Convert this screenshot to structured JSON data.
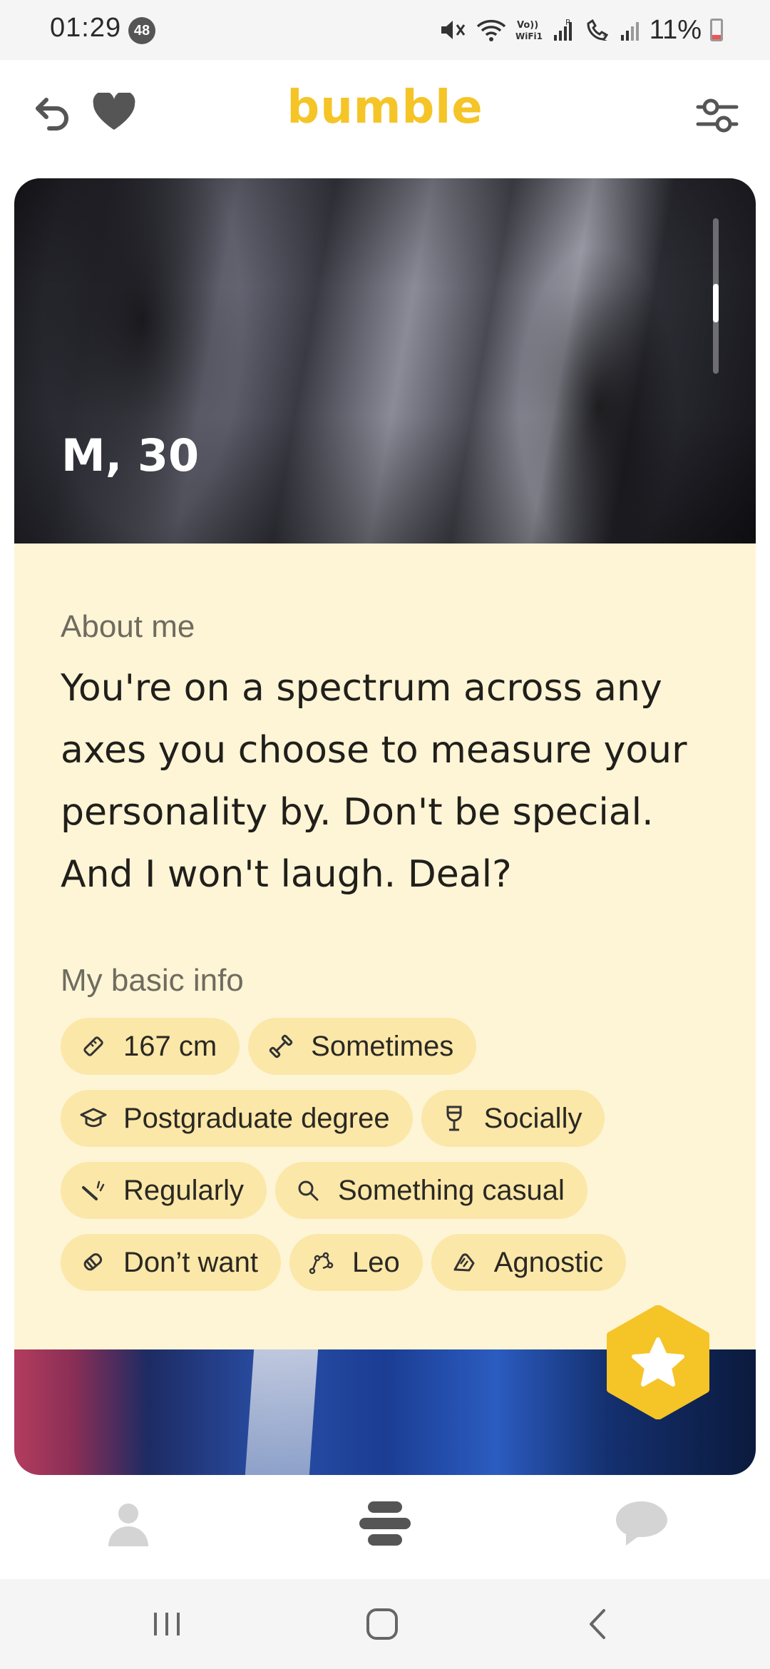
{
  "status_bar": {
    "time": "01:29",
    "notification_count": "48",
    "battery_percent": "11%",
    "icons": [
      "mute-icon",
      "wifi-icon",
      "volte-wifi-icon",
      "signal-icon",
      "wifi-calling-icon",
      "signal-icon",
      "battery-icon"
    ]
  },
  "header": {
    "logo": "bumble",
    "logo_color": "#f5c427",
    "left_icons": [
      "undo-icon",
      "heart-icon"
    ],
    "right_icon": "filter-sliders-icon"
  },
  "profile": {
    "name_age": "M, 30",
    "about_label": "About me",
    "about_text": "You're on a spectrum across any axes you choose to measure your personality by. Don't be special. And I won't laugh. Deal?",
    "basic_info_label": "My basic info",
    "basic_info": [
      {
        "icon": "ruler-icon",
        "label": "167 cm"
      },
      {
        "icon": "dumbbell-icon",
        "label": "Sometimes"
      },
      {
        "icon": "graduation-cap-icon",
        "label": "Postgraduate degree"
      },
      {
        "icon": "wine-glass-icon",
        "label": "Socially"
      },
      {
        "icon": "cigarette-icon",
        "label": "Regularly"
      },
      {
        "icon": "magnifier-icon",
        "label": "Something casual"
      },
      {
        "icon": "pacifier-icon",
        "label": "Don’t want"
      },
      {
        "icon": "constellation-icon",
        "label": "Leo"
      },
      {
        "icon": "praying-hands-icon",
        "label": "Agnostic"
      }
    ],
    "chip_color": "#fbe7a8",
    "card_background": "#fdf5d6"
  },
  "superlike_button": {
    "icon": "star-icon",
    "color": "#f5c427"
  },
  "bottom_nav": {
    "items": [
      {
        "icon": "profile-icon",
        "active": false
      },
      {
        "icon": "swipe-stack-icon",
        "active": true
      },
      {
        "icon": "chat-bubble-icon",
        "active": false
      }
    ]
  },
  "system_nav": {
    "items": [
      "recents-icon",
      "home-icon",
      "back-icon"
    ]
  }
}
